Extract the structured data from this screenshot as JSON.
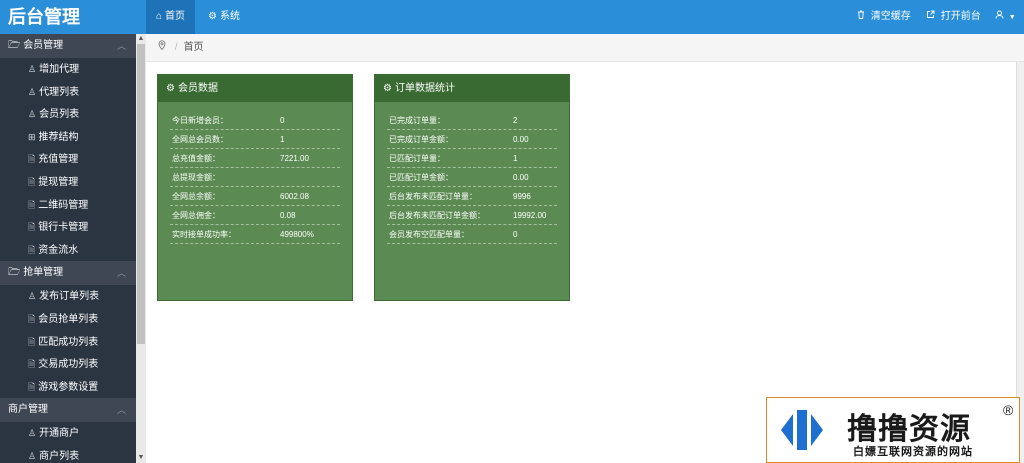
{
  "app": {
    "title": "后台管理"
  },
  "tabs": [
    {
      "icon": "home-icon",
      "glyph": "⌂",
      "label": "首页"
    },
    {
      "icon": "gear-icon",
      "glyph": "⚙",
      "label": "系统"
    }
  ],
  "header_actions": {
    "clear_cache": "清空缓存",
    "open_frontend": "打开前台"
  },
  "sidebar": {
    "groups": [
      {
        "label": "会员管理",
        "items": [
          "增加代理",
          "代理列表",
          "会员列表",
          "推荐结构",
          "充值管理",
          "提现管理",
          "二维码管理",
          "银行卡管理",
          "资金流水"
        ]
      },
      {
        "label": "抢单管理",
        "items": [
          "发布订单列表",
          "会员抢单列表",
          "匹配成功列表",
          "交易成功列表",
          "游戏参数设置"
        ]
      },
      {
        "label": "商户管理",
        "items": [
          "开通商户",
          "商户列表"
        ]
      }
    ]
  },
  "breadcrumb": {
    "current": "首页"
  },
  "cards": [
    {
      "title": "会员数据",
      "rows": [
        {
          "label": "今日新增会员：",
          "value": "0"
        },
        {
          "label": "全网总会员数：",
          "value": "1"
        },
        {
          "label": "总充值金额：",
          "value": "7221.00"
        },
        {
          "label": "总提现金额：",
          "value": ""
        },
        {
          "label": "全网总余额：",
          "value": "6002.08"
        },
        {
          "label": "全网总佣金：",
          "value": "0.08"
        },
        {
          "label": "实时接单成功率：",
          "value": "499800%"
        }
      ]
    },
    {
      "title": "订单数据统计",
      "rows": [
        {
          "label": "已完成订单量：",
          "value": "2"
        },
        {
          "label": "已完成订单金额：",
          "value": "0.00"
        },
        {
          "label": "已匹配订单量：",
          "value": "1"
        },
        {
          "label": "已匹配订单金额：",
          "value": "0.00"
        },
        {
          "label": "后台发布未匹配订单量：",
          "value": "9996"
        },
        {
          "label": "后台发布未匹配订单金额：",
          "value": "19992.00"
        },
        {
          "label": "会员发布空匹配单量：",
          "value": "0"
        }
      ]
    }
  ],
  "watermark": {
    "title": "撸撸资源",
    "subtitle": "白嫖互联网资源的网站",
    "reg": "®"
  },
  "colors": {
    "header": "#2b8ed8",
    "sidebar": "#2b3542",
    "card": "#5b8a52",
    "card_header": "#386a31"
  }
}
